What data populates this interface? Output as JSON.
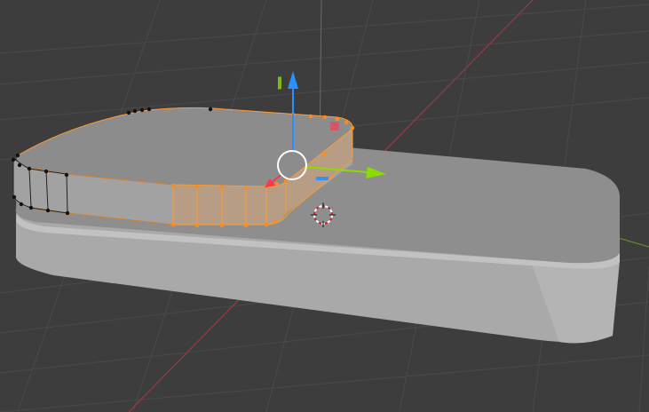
{
  "viewport": {
    "background": "#3d3d3d",
    "grid_color": "#4a4a4a",
    "axis_x_color": "#9a3a45",
    "axis_y_color": "#5e8a2a"
  },
  "mesh": {
    "base_slab_color": "#a9a9a9",
    "top_face_color": "#8e8e8e",
    "selection_color": "#ff8c1a",
    "vertex_color": "#111111"
  },
  "gizmo": {
    "x_axis_color": "#ff3352",
    "y_axis_color": "#8bdc00",
    "z_axis_color": "#2890ff",
    "pivot_ring_color": "#ffffff"
  },
  "cursor_3d": {
    "colors": [
      "#ffffff",
      "#cc2222"
    ]
  }
}
